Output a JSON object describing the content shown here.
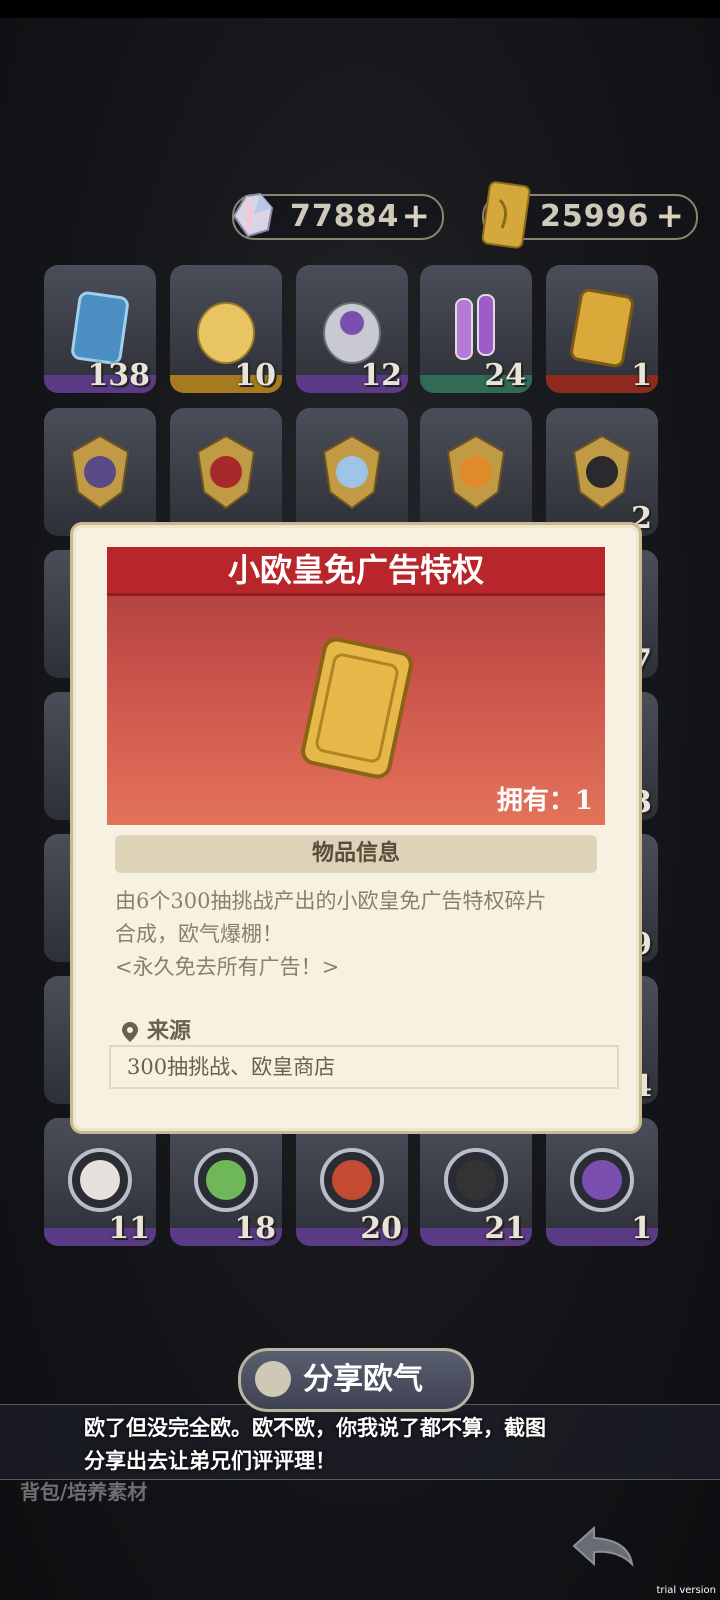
{
  "currency": {
    "gems": "77884",
    "tickets": "25996",
    "plus": "+"
  },
  "grid_row1": [
    {
      "count": "138",
      "icon": "free-ticket-blue-icon",
      "rarity": "purple"
    },
    {
      "count": "10",
      "icon": "gold-egg-icon",
      "rarity": "gold"
    },
    {
      "count": "12",
      "icon": "silver-egg-icon",
      "rarity": "purple"
    },
    {
      "count": "24",
      "icon": "potion-vials-icon",
      "rarity": "green"
    },
    {
      "count": "1",
      "icon": "free-ticket-gold-icon",
      "rarity": "red"
    }
  ],
  "grid_rows_partial_counts": [
    "2",
    "7",
    "3",
    "9",
    "4"
  ],
  "grid_last_row": [
    {
      "count": "11",
      "icon": "character-portrait-icon"
    },
    {
      "count": "18",
      "icon": "character-portrait-icon"
    },
    {
      "count": "20",
      "icon": "character-portrait-icon"
    },
    {
      "count": "21",
      "icon": "character-portrait-icon"
    },
    {
      "count": "1",
      "icon": "character-portrait-icon"
    }
  ],
  "modal": {
    "title": "小欧皇免广告特权",
    "owned": "拥有：1",
    "info_header": "物品信息",
    "desc_line1": "由6个300抽挑战产出的小欧皇免广告特权碎片",
    "desc_line2": "合成，欧气爆棚！",
    "desc_line3": "<永久免去所有广告！>",
    "source_label": "来源",
    "source_value": "300抽挑战、欧皇商店"
  },
  "share": {
    "label": "分享欧气"
  },
  "caption": {
    "line1": "欧了但没完全欧。欧不欧，你我说了都不算，截图",
    "line2": "分享出去让弟兄们评评理！"
  },
  "bottom": {
    "bag_label": "背包/培养素材"
  },
  "watermark": "trial version",
  "colors": {
    "title_red": "#b8262b",
    "modal_bg": "#f7f1e2"
  }
}
